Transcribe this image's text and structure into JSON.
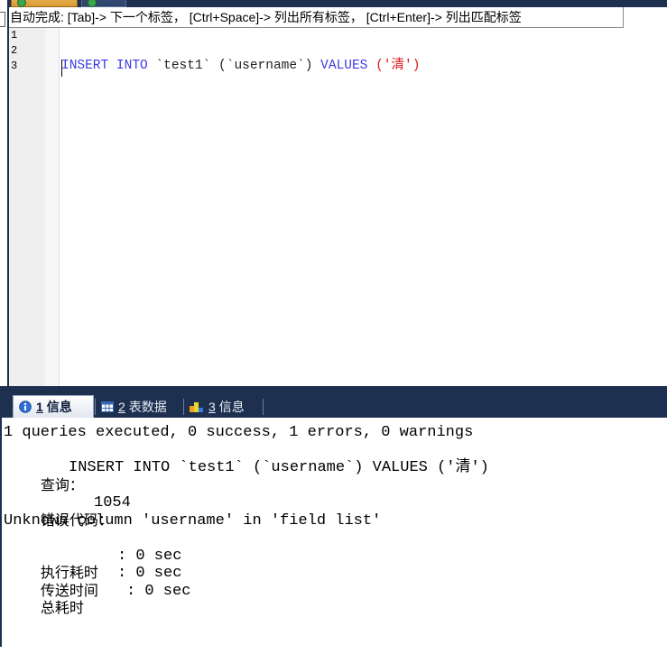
{
  "colors": {
    "navy": "#1e3050"
  },
  "top_tabs": [
    {
      "icon": "query-tab-icon"
    },
    {
      "icon": "query-tab-icon"
    }
  ],
  "editor": {
    "autocomplete_hint": "自动完成: [Tab]-> 下一个标签， [Ctrl+Space]-> 列出所有标签， [Ctrl+Enter]-> 列出匹配标签",
    "line_numbers": [
      "1",
      "2",
      "3"
    ],
    "lines": [
      {
        "tokens": [
          {
            "text": "INSERT INTO ",
            "color": "#3b3be0"
          },
          {
            "text": "`test1` ",
            "color": "#222222"
          },
          {
            "text": "(`username`) ",
            "color": "#222222"
          },
          {
            "text": "VALUES ",
            "color": "#3b3be0"
          },
          {
            "text": "('清')",
            "color": "#e01818"
          }
        ]
      },
      {
        "tokens": []
      },
      {
        "tokens": []
      }
    ]
  },
  "results": {
    "tabs": [
      {
        "number": "1",
        "label": "信息",
        "icon": "info-icon",
        "active": true
      },
      {
        "number": "2",
        "label": "表数据",
        "icon": "table-grid-icon",
        "active": false
      },
      {
        "number": "3",
        "label": "信息",
        "icon": "profiler-icon",
        "active": false
      }
    ],
    "summary": "1 queries executed, 0 success, 1 errors, 0 warnings",
    "query": {
      "label": "查询：",
      "sql": "INSERT INTO `test1` (`username`) VALUES ('清')"
    },
    "error": {
      "label": "错误代码：",
      "code": "1054",
      "message": "Unknown column 'username' in 'field list'"
    },
    "timings": [
      {
        "label": "执行耗时",
        "value": ": 0 sec"
      },
      {
        "label": "传送时间",
        "value": ": 0 sec"
      },
      {
        "label": "总耗时",
        "value": ": 0 sec"
      }
    ]
  }
}
